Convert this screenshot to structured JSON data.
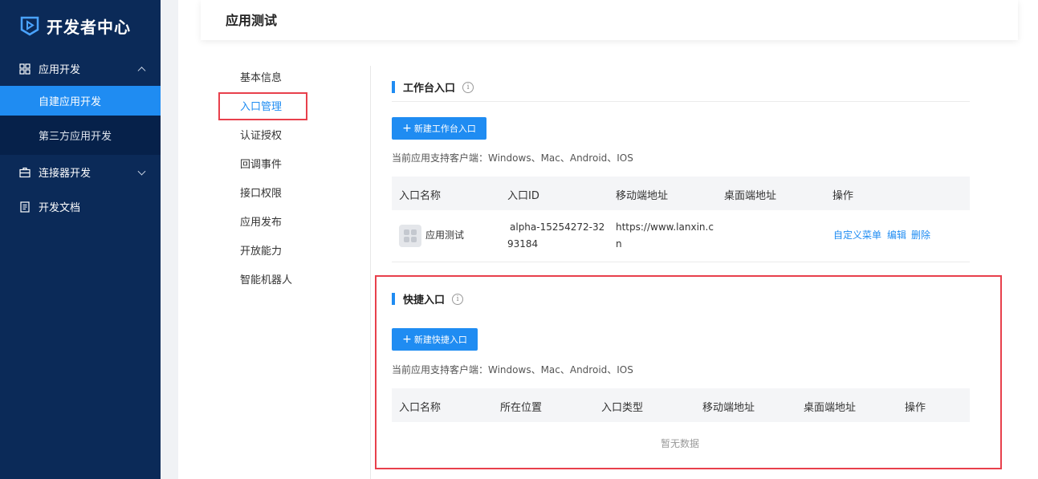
{
  "brand": {
    "name": "开发者中心"
  },
  "sidebar": {
    "app_dev": "应用开发",
    "self_built": "自建应用开发",
    "third_party": "第三方应用开发",
    "connector": "连接器开发",
    "docs": "开发文档"
  },
  "page": {
    "title": "应用测试"
  },
  "subnav": [
    "基本信息",
    "入口管理",
    "认证授权",
    "回调事件",
    "接口权限",
    "应用发布",
    "开放能力",
    "智能机器人"
  ],
  "workbench": {
    "title": "工作台入口",
    "button": "新建工作台入口",
    "support": "当前应用支持客户端：Windows、Mac、Android、IOS",
    "columns": [
      "入口名称",
      "入口ID",
      "移动端地址",
      "桌面端地址",
      "操作"
    ],
    "row": {
      "name": "应用测试",
      "id_line1": "alpha-15254272-32",
      "id_line2": "93184",
      "mobile_line1": "https://www.lanxin.c",
      "mobile_line2": "n",
      "desktop": "",
      "actions": [
        "自定义菜单",
        "编辑",
        "删除"
      ]
    }
  },
  "quick": {
    "title": "快捷入口",
    "button": "新建快捷入口",
    "support": "当前应用支持客户端：Windows、Mac、Android、IOS",
    "columns": [
      "入口名称",
      "所在位置",
      "入口类型",
      "移动端地址",
      "桌面端地址",
      "操作"
    ],
    "empty": "暂无数据"
  },
  "colors": {
    "primary": "#1f8cf2",
    "sidebar": "#0b2a58",
    "highlight": "#e8404c"
  }
}
